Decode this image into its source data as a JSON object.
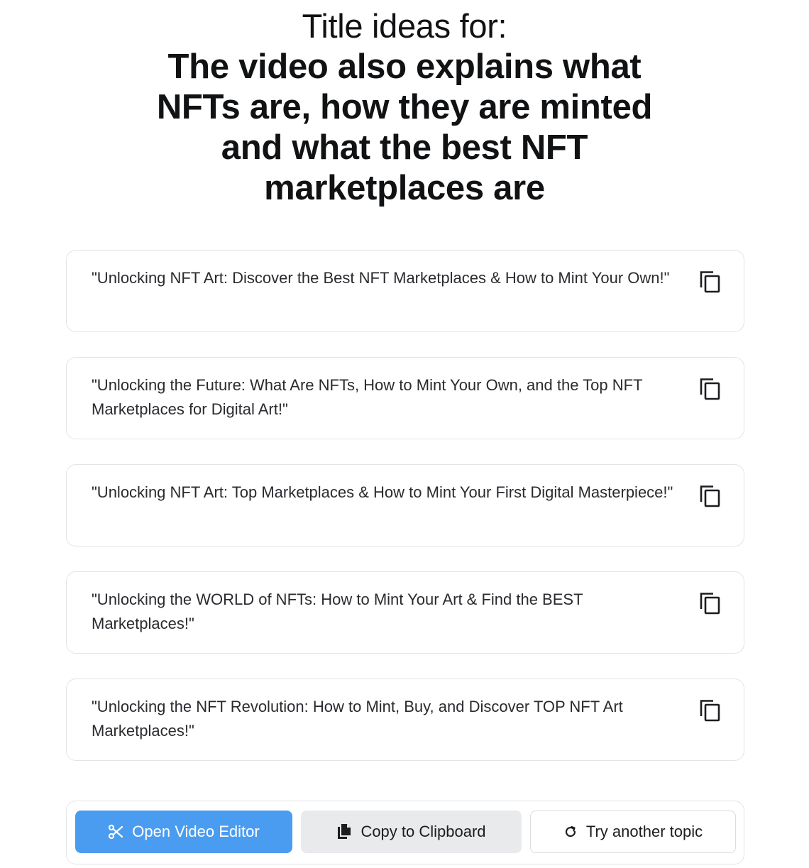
{
  "header": {
    "label": "Title ideas for:",
    "topic": "The video also explains what NFTs are, how they are minted and what the best NFT marketplaces are"
  },
  "ideas": [
    {
      "text": "\"Unlocking NFT Art: Discover the Best NFT Marketplaces & How to Mint Your Own!\"",
      "icon": "copy-icon"
    },
    {
      "text": "\"Unlocking the Future: What Are NFTs, How to Mint Your Own, and the Top NFT Marketplaces for Digital Art!\"",
      "icon": "copy-icon"
    },
    {
      "text": "\"Unlocking NFT Art: Top Marketplaces & How to Mint Your First Digital Masterpiece!\"",
      "icon": "copy-icon"
    },
    {
      "text": "\"Unlocking the WORLD of NFTs: How to Mint Your Art & Find the BEST Marketplaces!\"",
      "icon": "copy-icon"
    },
    {
      "text": "\"Unlocking the NFT Revolution: How to Mint, Buy, and Discover TOP NFT Art Marketplaces!\"",
      "icon": "copy-icon"
    }
  ],
  "toolbar": {
    "open_editor_label": "Open Video Editor",
    "open_editor_icon": "scissors-icon",
    "copy_label": "Copy to Clipboard",
    "copy_icon": "files-icon",
    "retry_label": "Try another topic",
    "retry_icon": "refresh-icon"
  },
  "colors": {
    "primary": "#4a9cf0",
    "secondary_bg": "#e9eaec",
    "border": "#e3e4e7",
    "text": "#1c1d20"
  }
}
